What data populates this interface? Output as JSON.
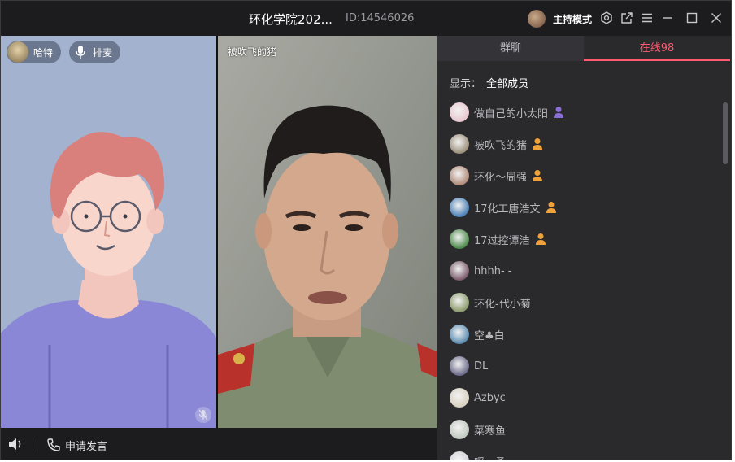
{
  "titlebar": {
    "title": "环化学院202...",
    "room_id": "ID:14546026",
    "host_mode_label": "主持模式",
    "icons": [
      "settings-icon",
      "popout-icon",
      "menu-icon",
      "minimize-icon",
      "maximize-icon",
      "close-icon"
    ]
  },
  "stage": {
    "left_tile": {
      "user_pill_label": "哈特",
      "mic_pill_label": "排麦"
    },
    "right_tile": {
      "user_name": "被吹飞的猪"
    }
  },
  "bottombar": {
    "apply_label": "申请发言"
  },
  "panel": {
    "tabs": [
      {
        "label": "群聊"
      },
      {
        "label": "在线98"
      }
    ],
    "filter": {
      "label": "显示：",
      "value": "全部成员"
    },
    "members": [
      {
        "name": "做自己的小太阳",
        "role": "host",
        "avatar_color": "#e8c7cf"
      },
      {
        "name": "被吹飞的猪",
        "role": "speaker",
        "avatar_color": "#9c8f7a"
      },
      {
        "name": "环化～周强",
        "role": "speaker",
        "avatar_color": "#b08a78"
      },
      {
        "name": "17化工唐浩文",
        "role": "speaker",
        "avatar_color": "#4a7fb5"
      },
      {
        "name": "17过控谭浩",
        "role": "speaker",
        "avatar_color": "#4c8a4a"
      },
      {
        "name": "hhhh- -",
        "role": "",
        "avatar_color": "#7a5a6a"
      },
      {
        "name": "环化-代小菊",
        "role": "",
        "avatar_color": "#8a9a6a"
      },
      {
        "name": "空♣白",
        "role": "",
        "avatar_color": "#5a8ab0"
      },
      {
        "name": "DL",
        "role": "",
        "avatar_color": "#6a6a8a"
      },
      {
        "name": "Azbyc",
        "role": "",
        "avatar_color": "#d8d0c0"
      },
      {
        "name": "菜寒鱼",
        "role": "",
        "avatar_color": "#c0c8c0"
      },
      {
        "name": "暖、柔",
        "role": "",
        "avatar_color": "#d0d0d8"
      }
    ]
  },
  "colors": {
    "accent": "#ff5a6e",
    "host_role": "#8a6fd6",
    "speaker_role": "#f0a23a"
  }
}
